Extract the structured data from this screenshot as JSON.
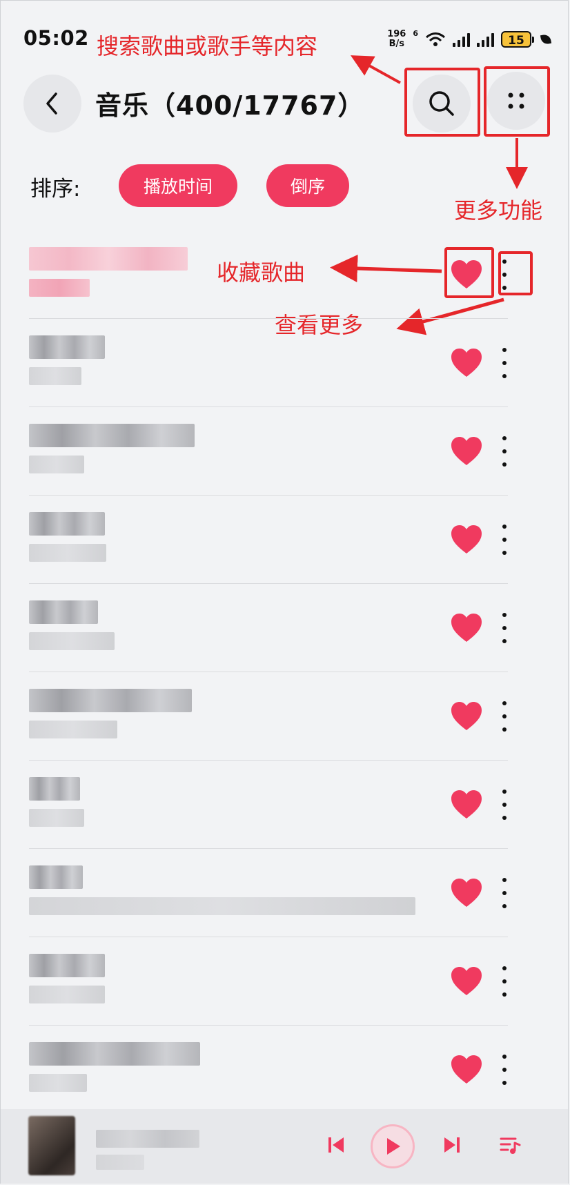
{
  "status_bar": {
    "time": "05:02",
    "net_speed_value": "196",
    "net_speed_unit": "B/s",
    "network_type": "6",
    "battery": "15"
  },
  "header": {
    "title": "音乐（400/17767）",
    "back_icon": "chevron-left-icon",
    "search_icon": "search-icon",
    "more_icon": "four-dots-icon"
  },
  "sort": {
    "label": "排序:",
    "options": [
      "播放时间",
      "倒序"
    ]
  },
  "annotations": {
    "search": "搜索歌曲或歌手等内容",
    "more": "更多功能",
    "favorite": "收藏歌曲",
    "view_more": "查看更多"
  },
  "colors": {
    "accent": "#f03a5f",
    "annotation": "#e5262a"
  },
  "songs_count_visible": 10,
  "player": {
    "controls": [
      "previous-icon",
      "play-icon",
      "next-icon",
      "playlist-icon"
    ]
  }
}
